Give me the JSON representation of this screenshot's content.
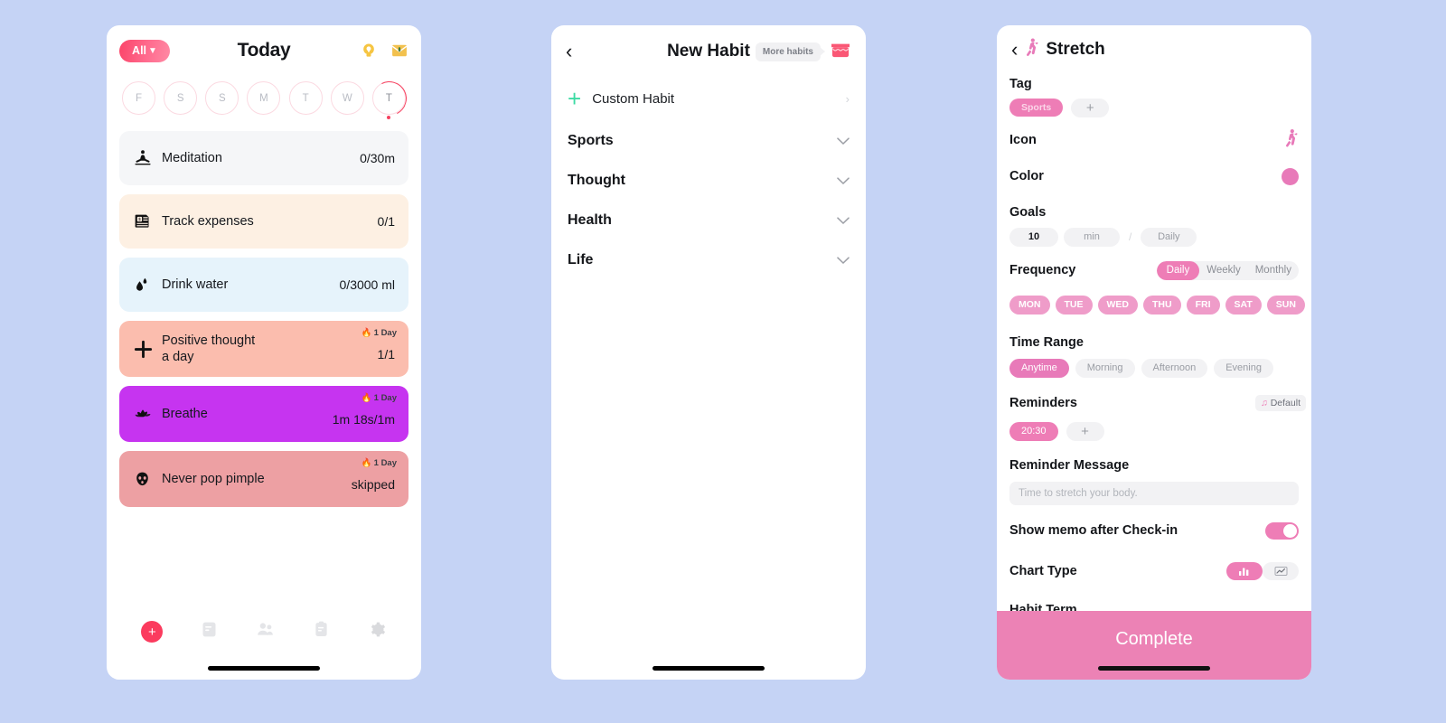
{
  "background_color": "#c5d3f5",
  "today": {
    "filter_pill": {
      "label": "All",
      "chevron": "chevron-down-icon"
    },
    "title": "Today",
    "actions": [
      {
        "name": "lightbulb-icon",
        "color": "#f5c242"
      },
      {
        "name": "inbox-icon",
        "color": "#f2c14e"
      }
    ],
    "week": [
      {
        "letter": "F",
        "active": false
      },
      {
        "letter": "S",
        "active": false
      },
      {
        "letter": "S",
        "active": false
      },
      {
        "letter": "M",
        "active": false
      },
      {
        "letter": "T",
        "active": false
      },
      {
        "letter": "W",
        "active": false
      },
      {
        "letter": "T",
        "active": true
      }
    ],
    "habits": [
      {
        "icon": "meditation-icon",
        "name": "Meditation",
        "value": "0/30m",
        "streak": "",
        "bg": "#f5f6f8"
      },
      {
        "icon": "receipt-icon",
        "name": "Track expenses",
        "value": "0/1",
        "streak": "",
        "bg": "#fdf0e3"
      },
      {
        "icon": "water-drop-icon",
        "name": "Drink water",
        "value": "0/3000 ml",
        "streak": "",
        "bg": "#e6f3fb"
      },
      {
        "icon": "plus-icon",
        "name": "Positive thought\na day",
        "value": "1/1",
        "streak": "1 Day",
        "bg": "#fbbdae"
      },
      {
        "icon": "lotus-icon",
        "name": "Breathe",
        "value": "1m 18s/1m",
        "streak": "1 Day",
        "bg": "#c634f0"
      },
      {
        "icon": "facemask-icon",
        "name": "Never pop pimple",
        "value": "skipped",
        "streak": "1 Day",
        "bg": "#eda0a3"
      }
    ],
    "tabs": [
      {
        "name": "add-button",
        "label": "+"
      },
      {
        "name": "notes-icon",
        "label": ""
      },
      {
        "name": "friends-icon",
        "label": ""
      },
      {
        "name": "clipboard-icon",
        "label": ""
      },
      {
        "name": "gear-icon",
        "label": ""
      }
    ]
  },
  "new_habit": {
    "back": "‹",
    "title": "New Habit",
    "more_habits_tooltip": "More habits",
    "shop_icon": "shop-icon",
    "custom_habit": {
      "label": "Custom Habit",
      "plus": "+"
    },
    "categories": [
      {
        "label": "Sports"
      },
      {
        "label": "Thought"
      },
      {
        "label": "Health"
      },
      {
        "label": "Life"
      }
    ]
  },
  "detail": {
    "back": "‹",
    "icon": "stretching-person-icon",
    "title": "Stretch",
    "tag": {
      "label": "Tag",
      "value": "Sports",
      "add": "+"
    },
    "icon_section": {
      "label": "Icon",
      "value": "stretching-person-icon"
    },
    "color_section": {
      "label": "Color",
      "value": "#e87ab9"
    },
    "goals": {
      "label": "Goals",
      "amount": "10",
      "unit": "min",
      "separator": "/",
      "period": "Daily"
    },
    "frequency": {
      "label": "Frequency",
      "options": [
        "Daily",
        "Weekly",
        "Monthly"
      ],
      "selected": "Daily",
      "days": [
        "MON",
        "TUE",
        "WED",
        "THU",
        "FRI",
        "SAT",
        "SUN"
      ]
    },
    "time_range": {
      "label": "Time Range",
      "options": [
        "Anytime",
        "Morning",
        "Afternoon",
        "Evening"
      ],
      "selected": "Anytime"
    },
    "reminders": {
      "label": "Reminders",
      "sound_badge": "Default",
      "times": [
        "20:30"
      ],
      "add": "+"
    },
    "reminder_message": {
      "label": "Reminder Message",
      "placeholder": "Time to stretch your body."
    },
    "show_memo": {
      "label": "Show memo after Check-in",
      "enabled": true
    },
    "chart_type": {
      "label": "Chart Type",
      "options": [
        "bar-chart-icon",
        "line-chart-icon"
      ],
      "selected": "bar-chart-icon"
    },
    "habit_term": {
      "label": "Habit Term"
    },
    "complete_button": "Complete"
  }
}
